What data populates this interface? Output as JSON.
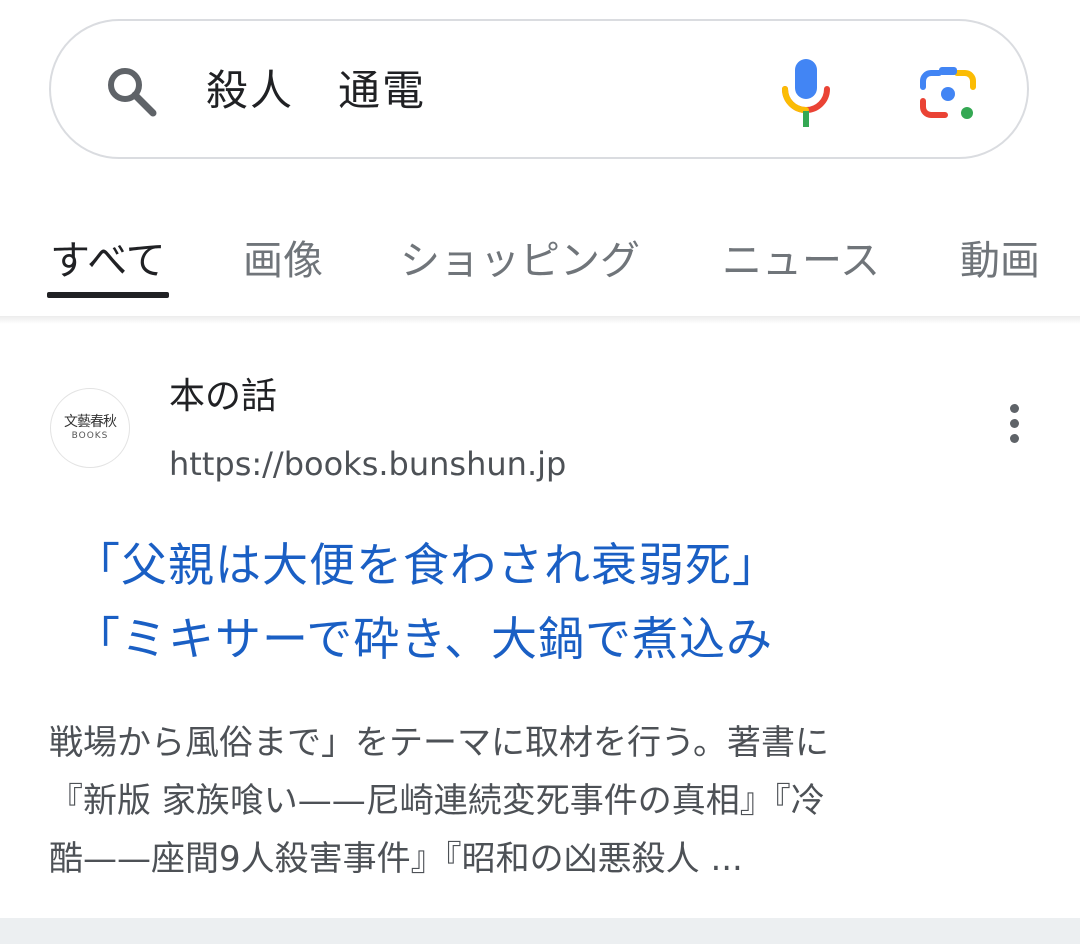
{
  "search": {
    "query": "殺人　通電"
  },
  "tabs": [
    {
      "label": "すべて",
      "active": true
    },
    {
      "label": "画像",
      "active": false
    },
    {
      "label": "ショッピング",
      "active": false
    },
    {
      "label": "ニュース",
      "active": false
    },
    {
      "label": "動画",
      "active": false
    }
  ],
  "result": {
    "favicon_text": "文藝春秋",
    "favicon_subtext": "BOOKS",
    "site_name": "本の話",
    "url": "https://books.bunshun.jp",
    "title_line1": "「父親は大便を食わされ衰弱死」",
    "title_line2": "「ミキサーで砕き、大鍋で煮込み",
    "snippet_line1": "戦場から風俗まで」をテーマに取材を行う。著書に",
    "snippet_line2": "『新版 家族喰い——尼崎連続変死事件の真相』『冷",
    "snippet_line3": "酷——座間9人殺害事件』『昭和の凶悪殺人 ..."
  },
  "colors": {
    "link": "#1a5fc4",
    "text": "#202124",
    "muted": "#70757a"
  }
}
